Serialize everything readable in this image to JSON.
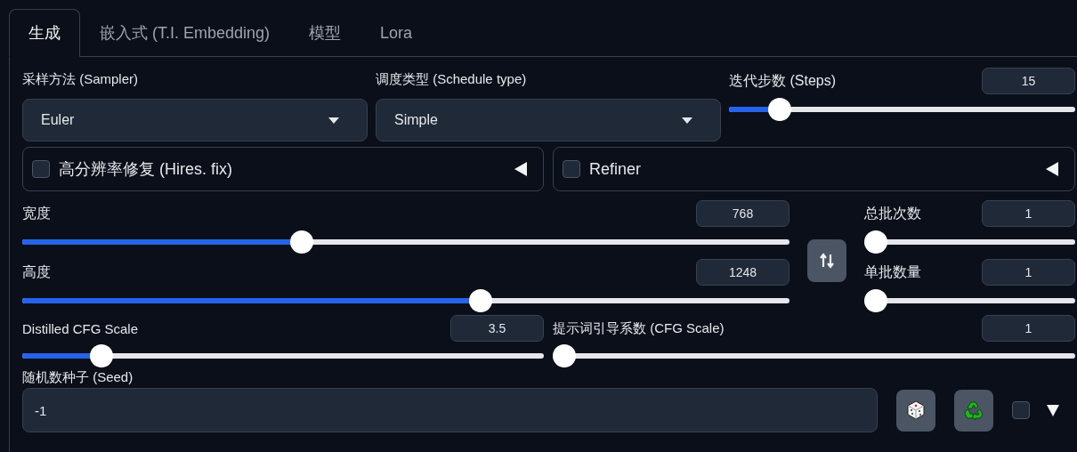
{
  "tabs": [
    {
      "label": "生成",
      "selected": true
    },
    {
      "label": "嵌入式 (T.I. Embedding)",
      "selected": false
    },
    {
      "label": "模型",
      "selected": false
    },
    {
      "label": "Lora",
      "selected": false
    }
  ],
  "sampler": {
    "label": "采样方法 (Sampler)",
    "value": "Euler"
  },
  "schedule": {
    "label": "调度类型 (Schedule type)",
    "value": "Simple"
  },
  "steps": {
    "label": "迭代步数 (Steps)",
    "value": "15",
    "level": 0.12
  },
  "accordions": [
    {
      "label": "高分辨率修复 (Hires. fix)",
      "checked": false,
      "expanded": false
    },
    {
      "label": "Refiner",
      "checked": false,
      "expanded": false
    }
  ],
  "width": {
    "label": "宽度",
    "value": "768",
    "level": 0.36
  },
  "height": {
    "label": "高度",
    "value": "1248",
    "level": 0.6
  },
  "batch_count": {
    "label": "总批次数",
    "value": "1",
    "level": 0
  },
  "batch_size": {
    "label": "单批数量",
    "value": "1",
    "level": 0
  },
  "distilled_cfg": {
    "label": "Distilled CFG Scale",
    "value": "3.5",
    "level": 0.135
  },
  "cfg_scale": {
    "label": "提示词引导系数 (CFG Scale)",
    "value": "1",
    "level": 0
  },
  "seed": {
    "label": "随机数种子 (Seed)",
    "value": "-1",
    "extra_checked": false
  }
}
